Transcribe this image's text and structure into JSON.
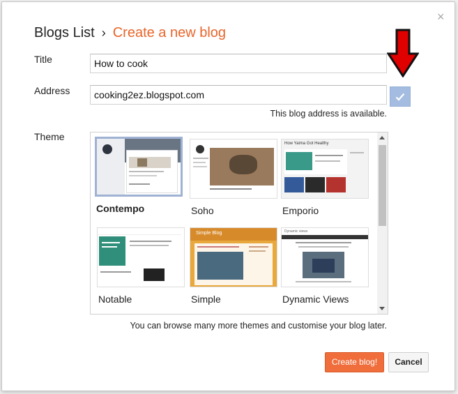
{
  "dialog": {
    "close_glyph": "×",
    "breadcrumb": {
      "parent": "Blogs List",
      "separator": "›",
      "current": "Create a new blog"
    }
  },
  "form": {
    "title_label": "Title",
    "title_value": "How to cook",
    "address_label": "Address",
    "address_value": "cooking2ez.blogspot.com",
    "address_status": "This blog address is available.",
    "theme_label": "Theme"
  },
  "themes": [
    {
      "name": "Contempo",
      "selected": true
    },
    {
      "name": "Soho",
      "selected": false
    },
    {
      "name": "Emporio",
      "selected": false
    },
    {
      "name": "Notable",
      "selected": false
    },
    {
      "name": "Simple",
      "selected": false
    },
    {
      "name": "Dynamic Views",
      "selected": false
    }
  ],
  "thumb_text": {
    "emporio_heading": "How Yaima Got Healthy",
    "simple_heading": "Simple Blog",
    "dynamic_bar": "Dynamic views"
  },
  "hint": "You can browse many more themes and customise your blog later.",
  "buttons": {
    "create": "Create blog!",
    "cancel": "Cancel"
  },
  "colors": {
    "accent_orange": "#e8652a",
    "create_button": "#f06d3c",
    "check_button": "#a3bce0",
    "arrow_red": "#e00000"
  },
  "icons": {
    "close": "close-icon",
    "check": "check-icon",
    "annotation": "red-arrow-icon"
  }
}
